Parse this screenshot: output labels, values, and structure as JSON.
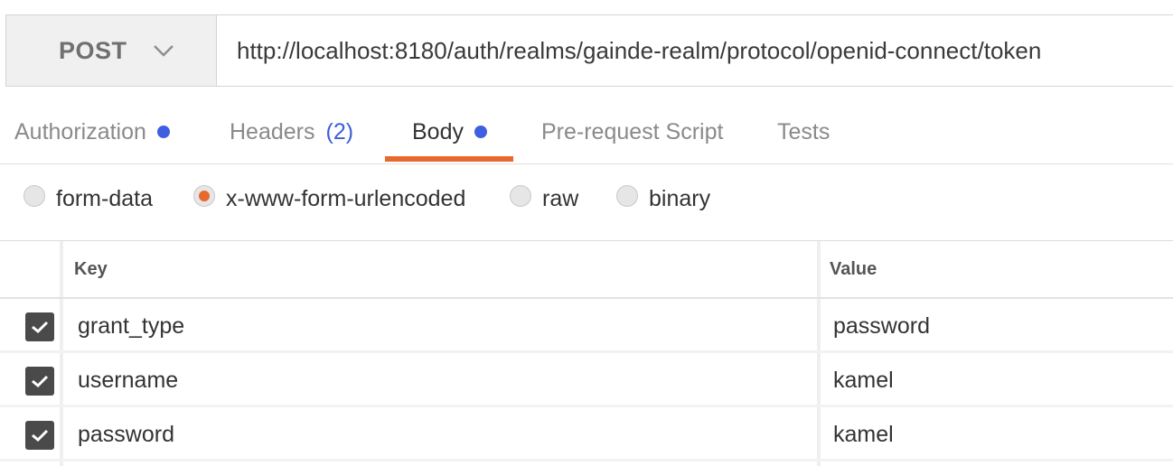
{
  "request": {
    "method": "POST",
    "url": "http://localhost:8180/auth/realms/gainde-realm/protocol/openid-connect/token"
  },
  "tabs": [
    {
      "label": "Authorization",
      "dot": true
    },
    {
      "label": "Headers",
      "count": "(2)"
    },
    {
      "label": "Body",
      "dot": true,
      "active": true
    },
    {
      "label": "Pre-request Script"
    },
    {
      "label": "Tests"
    }
  ],
  "body_types": [
    {
      "label": "form-data",
      "selected": false
    },
    {
      "label": "x-www-form-urlencoded",
      "selected": true
    },
    {
      "label": "raw",
      "selected": false
    },
    {
      "label": "binary",
      "selected": false
    }
  ],
  "table": {
    "headers": {
      "key": "Key",
      "value": "Value"
    },
    "rows": [
      {
        "checked": true,
        "key": "grant_type",
        "value": "password"
      },
      {
        "checked": true,
        "key": "username",
        "value": "kamel"
      },
      {
        "checked": true,
        "key": "password",
        "value": "kamel"
      }
    ]
  },
  "colors": {
    "accent": "#e8692e",
    "dot": "#3f5fe0",
    "count": "#3b5fd9"
  }
}
